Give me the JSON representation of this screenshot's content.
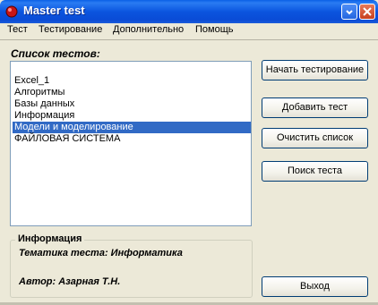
{
  "window": {
    "title": "Master test"
  },
  "menu": [
    "Тест",
    "Тестирование",
    "Дополнительно",
    "Помощь"
  ],
  "list": {
    "label": "Список тестов:",
    "items": [
      "Excel_1",
      "Алгоритмы",
      "Базы данных",
      "Информация",
      "Модели и моделирование",
      "ФАЙЛОВАЯ СИСТЕМА"
    ],
    "selected_index": 4
  },
  "buttons": {
    "start": "Начать тестирование",
    "add": "Добавить тест",
    "clear": "Очистить список",
    "search": "Поиск теста",
    "exit": "Выход"
  },
  "info": {
    "legend": "Информация",
    "topic": "Тематика теста: Информатика",
    "author": "Автор: Азарная Т.Н."
  },
  "icons": {
    "app": "red-circle-icon",
    "minimize": "minimize-icon",
    "close": "close-icon"
  },
  "colors": {
    "titlebar": "#0b55df",
    "selection": "#316ac5"
  }
}
